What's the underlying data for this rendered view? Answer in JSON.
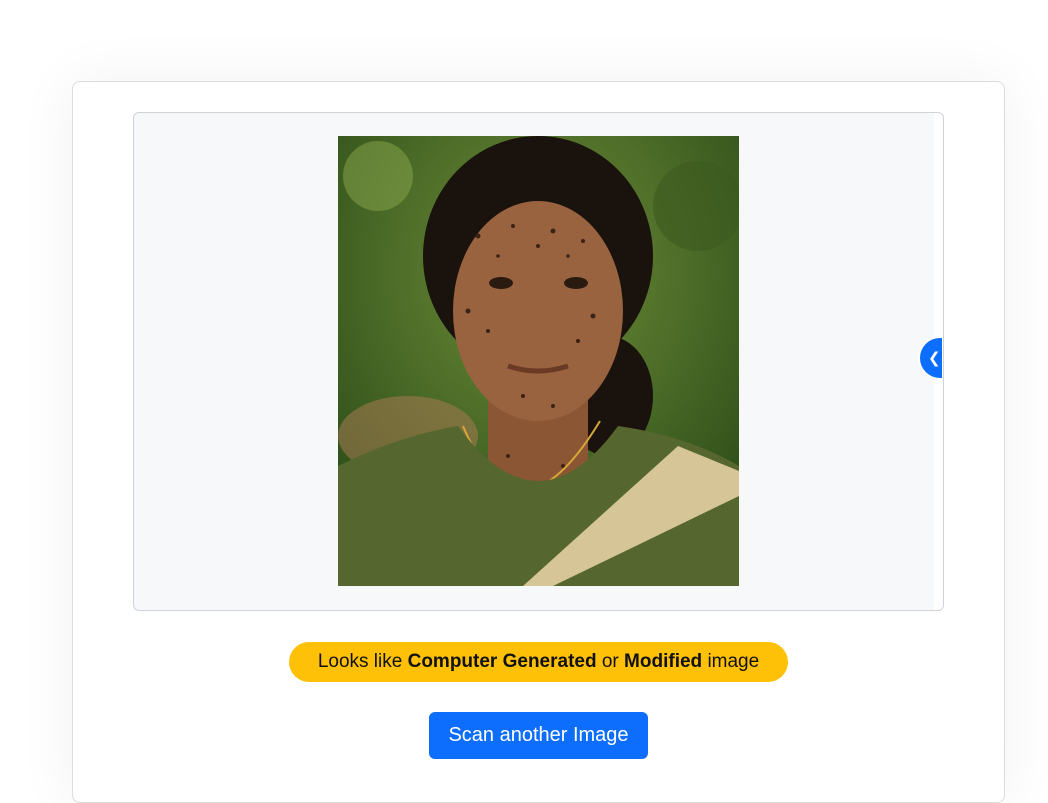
{
  "result": {
    "verdict_prefix": "Looks like",
    "verdict_strong_1": "Computer Generated",
    "verdict_join": "or",
    "verdict_strong_2": "Modified",
    "verdict_suffix": "image",
    "verdict_color": "#ffc107"
  },
  "actions": {
    "scan_another_label": "Scan another Image",
    "primary_color": "#0d6efd"
  },
  "preview": {
    "collapse_icon": "chevron-left-icon"
  }
}
